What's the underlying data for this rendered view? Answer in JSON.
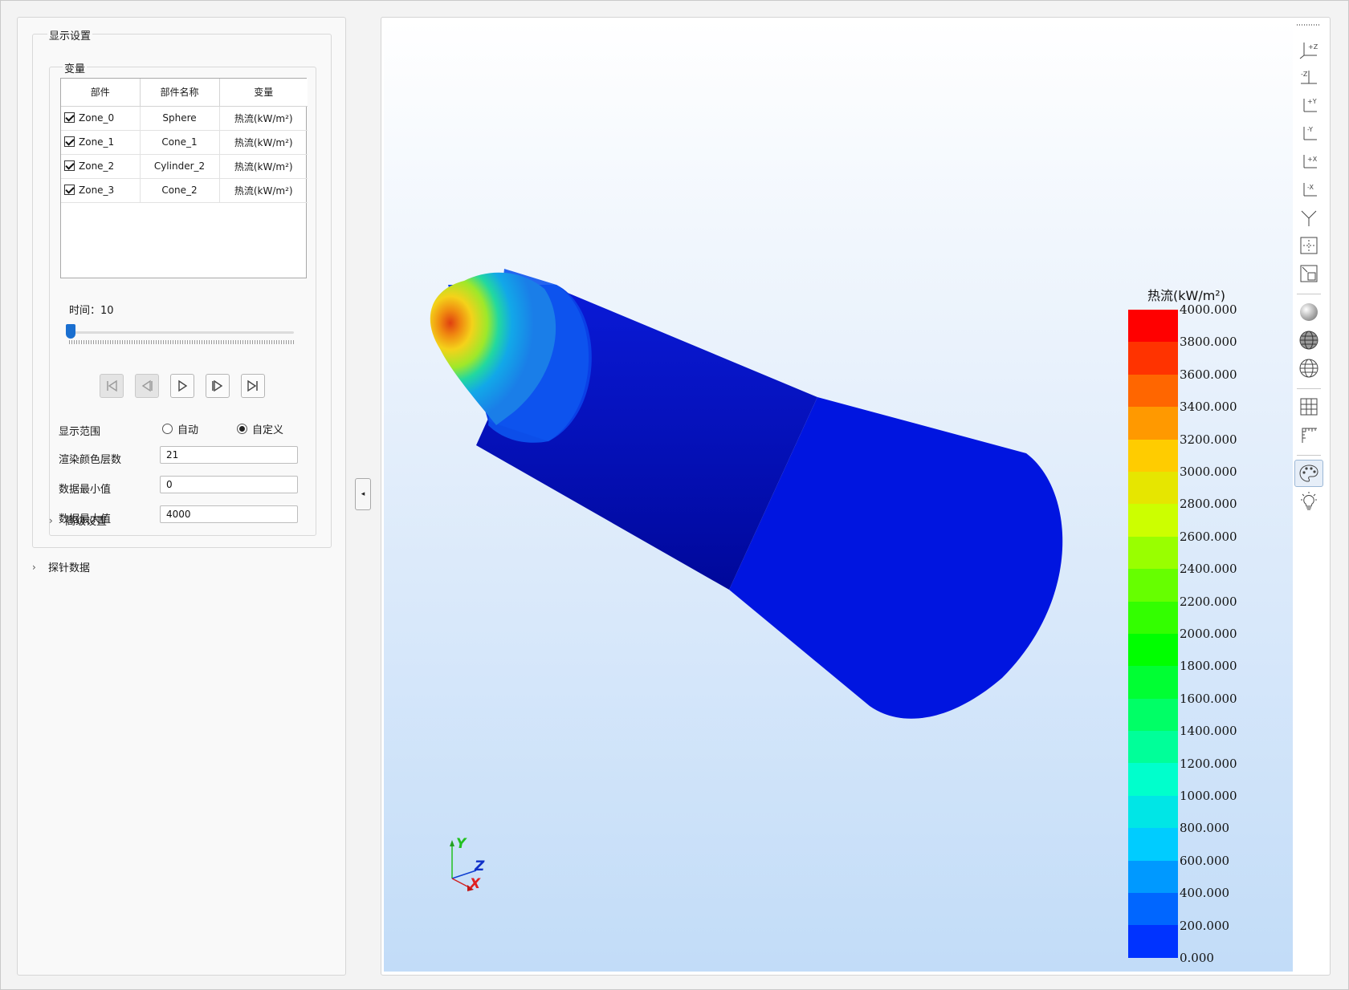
{
  "panel": {
    "display_group_title": "显示设置",
    "variable_group_title": "变量",
    "table_headers": [
      "部件",
      "部件名称",
      "变量"
    ],
    "rows": [
      {
        "zone": "Zone_0",
        "name": "Sphere",
        "variable": "热流(kW/m²)",
        "checked": true
      },
      {
        "zone": "Zone_1",
        "name": "Cone_1",
        "variable": "热流(kW/m²)",
        "checked": true
      },
      {
        "zone": "Zone_2",
        "name": "Cylinder_2",
        "variable": "热流(kW/m²)",
        "checked": true
      },
      {
        "zone": "Zone_3",
        "name": "Cone_2",
        "variable": "热流(kW/m²)",
        "checked": true
      }
    ],
    "time_label": "时间：10",
    "time_slider_fraction": 0.0,
    "playback": [
      "first-frame-icon",
      "step-back-icon",
      "play-icon",
      "step-forward-icon",
      "last-frame-icon"
    ],
    "range_label": "显示范围",
    "range_auto": "自动",
    "range_custom": "自定义",
    "range_selected": "自定义",
    "color_levels_label": "渲染颜色层数",
    "color_levels_value": "21",
    "min_label": "数据最小值",
    "min_value": "0",
    "max_label": "数据最大值",
    "max_value": "4000",
    "advanced_label": "高级设置",
    "probe_label": "探针数据"
  },
  "viewport": {
    "legend_title": "热流(kW/m²)",
    "legend_labels": [
      "4000.000",
      "3800.000",
      "3600.000",
      "3400.000",
      "3200.000",
      "3000.000",
      "2800.000",
      "2600.000",
      "2400.000",
      "2200.000",
      "2000.000",
      "1800.000",
      "1600.000",
      "1400.000",
      "1200.000",
      "1000.000",
      "800.000",
      "600.000",
      "400.000",
      "200.000",
      "0.000"
    ],
    "legend_colors": [
      "#ff0000",
      "#ff3300",
      "#ff6600",
      "#ff9900",
      "#ffcc00",
      "#e6e600",
      "#ccff00",
      "#99ff00",
      "#66ff00",
      "#33ff00",
      "#00ff00",
      "#00ff33",
      "#00ff66",
      "#00ff99",
      "#00ffcc",
      "#00e6e6",
      "#00ccff",
      "#0099ff",
      "#0066ff",
      "#0033ff",
      "#0000ff"
    ],
    "axis_labels": {
      "x": "X",
      "y": "Y",
      "z": "Z"
    }
  },
  "toolbar": [
    "view-plus-z-icon",
    "view-minus-z-icon",
    "view-plus-y-icon",
    "view-minus-y-icon",
    "view-plus-x-icon",
    "view-minus-x-icon",
    "isometric-view-icon",
    "fit-view-icon",
    "zoom-box-icon",
    "solid-sphere-icon",
    "wireframe-sphere-icon",
    "mesh-sphere-icon",
    "grid-icon",
    "ruler-icon",
    "palette-icon",
    "light-icon"
  ]
}
